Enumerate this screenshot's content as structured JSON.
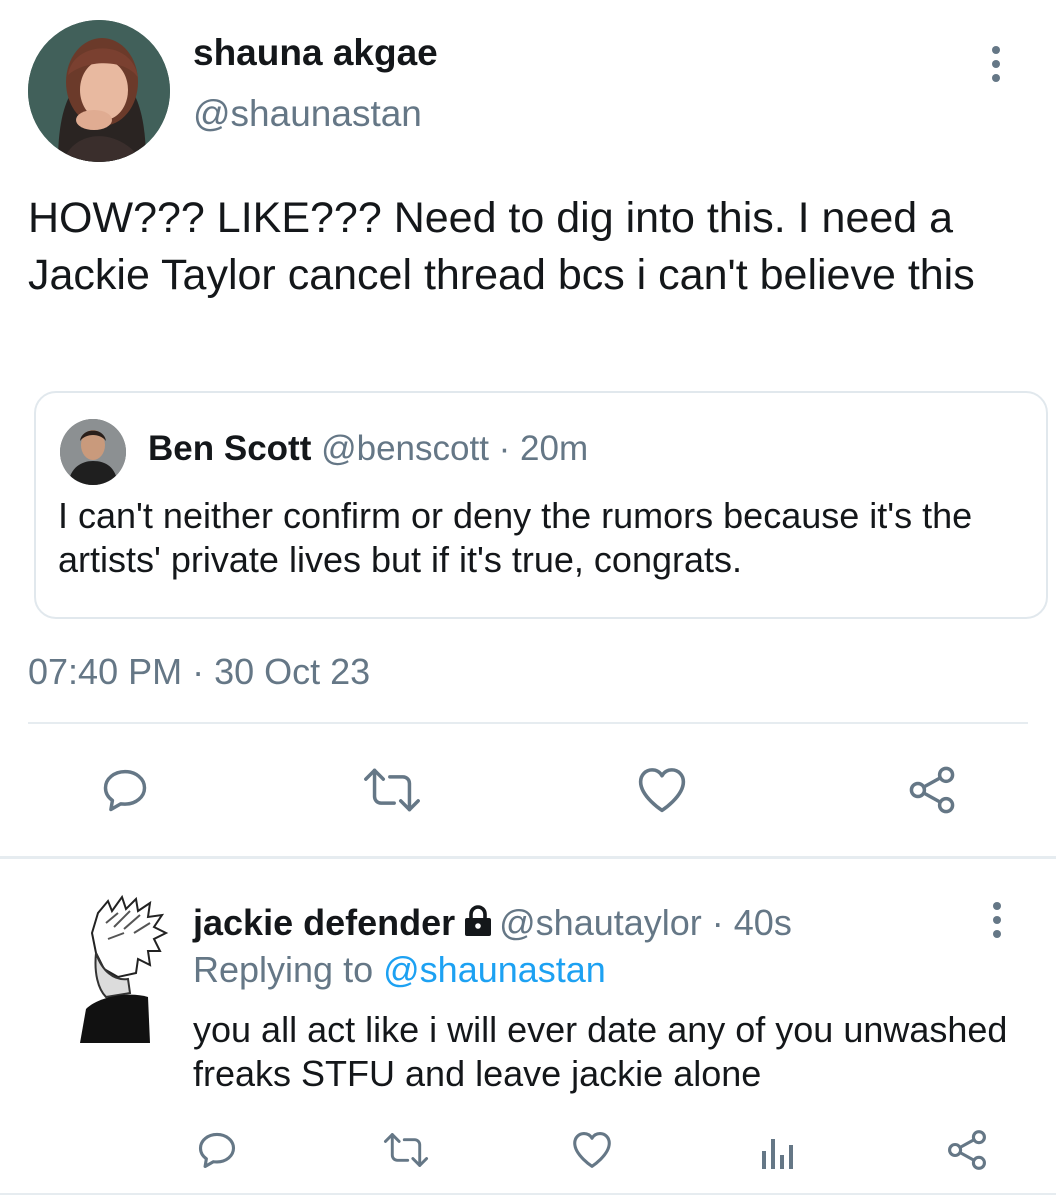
{
  "main_tweet": {
    "author_name": "shauna akgae",
    "author_handle": "@shaunastan",
    "text": "HOW??? LIKE??? Need to dig into this. I need a Jackie Taylor cancel thread bcs i can't believe this",
    "timestamp": "07:40 PM · 30 Oct 23",
    "quoted": {
      "author_name": "Ben Scott",
      "author_handle": "@benscott",
      "age": "· 20m",
      "text": "I can't neither confirm or deny the rumors because it's the artists' private lives but if it's true, congrats."
    }
  },
  "reply": {
    "author_name": "jackie defender",
    "author_handle": "@shautaylor",
    "age": "· 40s",
    "replying_prefix": "Replying to",
    "replying_handle": "@shaunastan",
    "text": "you all act like i will ever date any of you unwashed freaks STFU and leave jackie alone"
  },
  "icons": {
    "reply": "reply-icon",
    "retweet": "retweet-icon",
    "like": "heart-icon",
    "share": "share-icon",
    "analytics": "analytics-icon",
    "more": "more-vertical-icon",
    "lock": "lock-icon"
  },
  "colors": {
    "text": "#14171a",
    "muted": "#657786",
    "link": "#1da1f2",
    "divider": "#e6ecf0"
  }
}
